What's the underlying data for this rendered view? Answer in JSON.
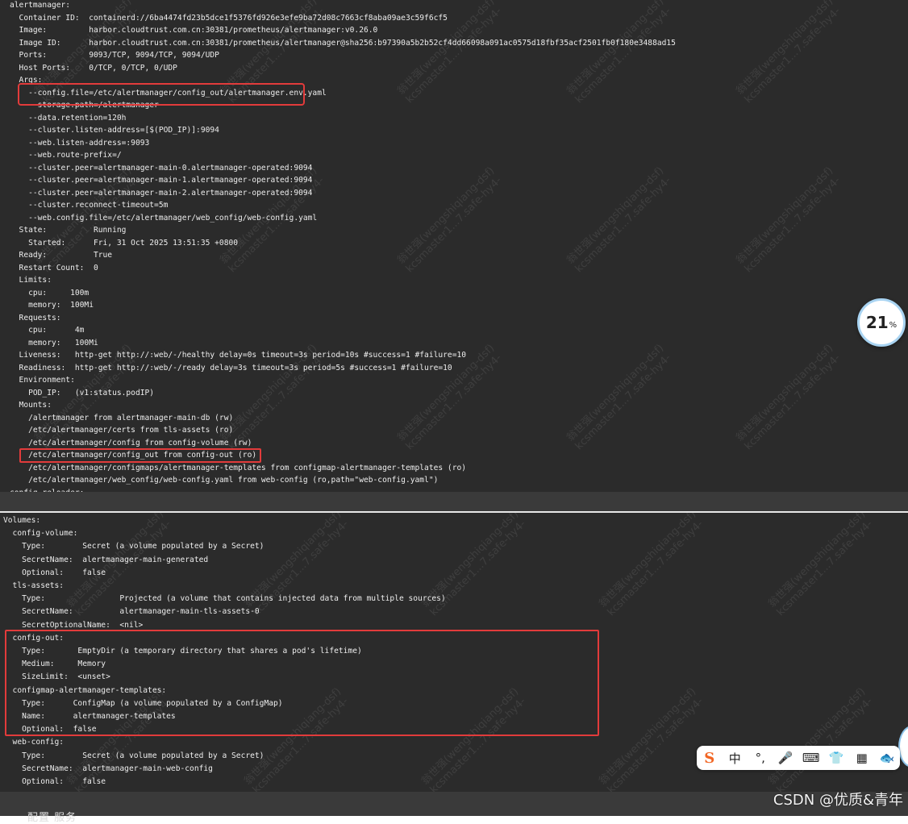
{
  "top_lines": [
    "alertmanager:",
    "  Container ID:  containerd://6ba4474fd23b5dce1f5376fd926e3efe9ba72d08c7663cf8aba09ae3c59f6cf5",
    "  Image:         harbor.cloudtrust.com.cn:30381/prometheus/alertmanager:v0.26.0",
    "  Image ID:      harbor.cloudtrust.com.cn:30381/prometheus/alertmanager@sha256:b97390a5b2b52cf4dd66098a091ac0575d18fbf35acf2501fb0f180e3488ad15",
    "  Ports:         9093/TCP, 9094/TCP, 9094/UDP",
    "  Host Ports:    0/TCP, 0/TCP, 0/UDP",
    "  Args:",
    "    --config.file=/etc/alertmanager/config_out/alertmanager.env.yaml",
    "    --storage.path=/alertmanager",
    "    --data.retention=120h",
    "    --cluster.listen-address=[$(POD_IP)]:9094",
    "    --web.listen-address=:9093",
    "    --web.route-prefix=/",
    "    --cluster.peer=alertmanager-main-0.alertmanager-operated:9094",
    "    --cluster.peer=alertmanager-main-1.alertmanager-operated:9094",
    "    --cluster.peer=alertmanager-main-2.alertmanager-operated:9094",
    "    --cluster.reconnect-timeout=5m",
    "    --web.config.file=/etc/alertmanager/web_config/web-config.yaml",
    "  State:          Running",
    "    Started:      Fri, 31 Oct 2025 13:51:35 +0800",
    "  Ready:          True",
    "  Restart Count:  0",
    "  Limits:",
    "    cpu:     100m",
    "    memory:  100Mi",
    "  Requests:",
    "    cpu:      4m",
    "    memory:   100Mi",
    "  Liveness:   http-get http://:web/-/healthy delay=0s timeout=3s period=10s #success=1 #failure=10",
    "  Readiness:  http-get http://:web/-/ready delay=3s timeout=3s period=5s #success=1 #failure=10",
    "  Environment:",
    "    POD_IP:   (v1:status.podIP)",
    "  Mounts:",
    "    /alertmanager from alertmanager-main-db (rw)",
    "    /etc/alertmanager/certs from tls-assets (ro)",
    "    /etc/alertmanager/config from config-volume (rw)",
    "    /etc/alertmanager/config_out from config-out (ro)",
    "    /etc/alertmanager/configmaps/alertmanager-templates from configmap-alertmanager-templates (ro)",
    "    /etc/alertmanager/web_config/web-config.yaml from web-config (ro,path=\"web-config.yaml\")",
    "config-reloader:"
  ],
  "bottom_lines": [
    "Volumes:",
    "  config-volume:",
    "    Type:        Secret (a volume populated by a Secret)",
    "    SecretName:  alertmanager-main-generated",
    "    Optional:    false",
    "  tls-assets:",
    "    Type:                Projected (a volume that contains injected data from multiple sources)",
    "    SecretName:          alertmanager-main-tls-assets-0",
    "    SecretOptionalName:  <nil>",
    "  config-out:",
    "    Type:       EmptyDir (a temporary directory that shares a pod's lifetime)",
    "    Medium:     Memory",
    "    SizeLimit:  <unset>",
    "  configmap-alertmanager-templates:",
    "    Type:      ConfigMap (a volume populated by a ConfigMap)",
    "    Name:      alertmanager-templates",
    "    Optional:  false",
    "  web-config:",
    "    Type:        Secret (a volume populated by a Secret)",
    "    SecretName:  alertmanager-main-web-config",
    "    Optional:    false",
    "  ..."
  ],
  "watermark": {
    "line1": "翁世强(wengshiqiang-dsf)",
    "line2": "kcsmaster1...7.safe-hy4-"
  },
  "zoom_badge": {
    "value": "21",
    "unit": "%"
  },
  "ime_toolbar": {
    "logo": "S",
    "mode": "中",
    "punct": "°,",
    "mic": "🎤",
    "keyboard": "⌨",
    "skin": "👕",
    "grid": "▦",
    "more": "🐟"
  },
  "csdn_mark": "CSDN @优质&青年",
  "cut_text": "配置          服务",
  "colors": {
    "terminal_bg": "#2b2b2b",
    "terminal_text": "#ededed",
    "highlight_red": "#e23b3b"
  }
}
